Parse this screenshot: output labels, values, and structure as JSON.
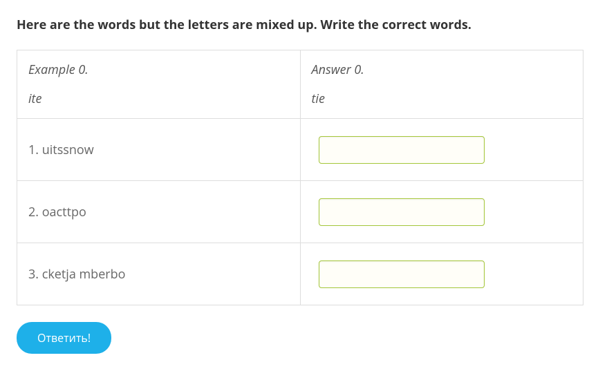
{
  "instructions": "Here are the words but the letters are mixed up. Write the correct words.",
  "example": {
    "leftLabel": "Example 0.",
    "leftValue": "ite",
    "rightLabel": "Answer 0.",
    "rightValue": "tie"
  },
  "questions": [
    {
      "label": "1. uitssnow",
      "value": ""
    },
    {
      "label": "2. oacttpo",
      "value": ""
    },
    {
      "label": "3. cketja mberbo",
      "value": ""
    }
  ],
  "submitLabel": "Ответить!"
}
